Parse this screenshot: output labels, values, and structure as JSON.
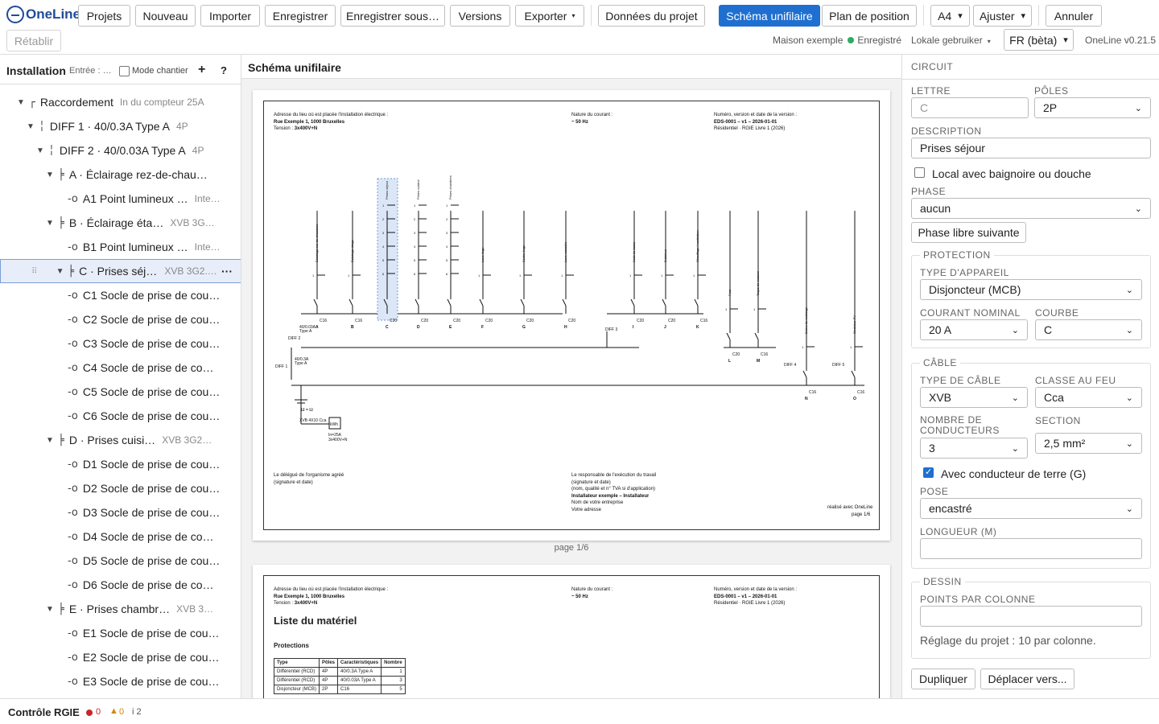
{
  "app": {
    "logo": "OneLine",
    "version": "OneLine v0.21.5"
  },
  "toolbar": {
    "projects": "Projets",
    "new": "Nouveau",
    "import": "Importer",
    "save": "Enregistrer",
    "save_as": "Enregistrer sous…",
    "versions": "Versions",
    "export": "Exporter",
    "project_data": "Données du projet",
    "single_line": "Schéma unifilaire",
    "position_plan": "Plan de position",
    "paper": "A4",
    "fit": "Ajuster",
    "undo": "Annuler",
    "redo": "Rétablir",
    "project_name": "Maison exemple",
    "saved": "Enregistré",
    "locale_user": "Lokale gebruiker",
    "language": "FR (bèta)"
  },
  "left": {
    "title": "Installation",
    "entry": "Entrée : …",
    "site_mode": "Mode chantier",
    "add": "+",
    "help": "?",
    "tree": [
      {
        "indent": 0,
        "tw": "▼",
        "icon": "┌",
        "label": "Raccordement",
        "sub": "In du compteur 25A"
      },
      {
        "indent": 1,
        "tw": "▼",
        "icon": "╎",
        "label": "DIFF 1 · 40/0.3A Type A",
        "sub": "4P"
      },
      {
        "indent": 2,
        "tw": "▼",
        "icon": "╎",
        "label": "DIFF 2 · 40/0.03A Type A",
        "sub": "4P"
      },
      {
        "indent": 3,
        "tw": "▼",
        "icon": "╞",
        "label": "A · Éclairage rez-de-chau…",
        "sub": ""
      },
      {
        "indent": 4,
        "tw": "",
        "icon": "-o",
        "label": "A1 Point lumineux …",
        "sub": "Inte…"
      },
      {
        "indent": 3,
        "tw": "▼",
        "icon": "╞",
        "label": "B · Éclairage éta…",
        "sub": "XVB 3G…"
      },
      {
        "indent": 4,
        "tw": "",
        "icon": "-o",
        "label": "B1 Point lumineux …",
        "sub": "Inte…"
      },
      {
        "indent": 3,
        "tw": "▼",
        "icon": "╞",
        "label": "C · Prises séjo…",
        "sub": "XVB 3G2.5 …",
        "selected": true
      },
      {
        "indent": 4,
        "tw": "",
        "icon": "-o",
        "label": "C1 Socle de prise de cou…",
        "sub": ""
      },
      {
        "indent": 4,
        "tw": "",
        "icon": "-o",
        "label": "C2 Socle de prise de cou…",
        "sub": ""
      },
      {
        "indent": 4,
        "tw": "",
        "icon": "-o",
        "label": "C3 Socle de prise de cou…",
        "sub": ""
      },
      {
        "indent": 4,
        "tw": "",
        "icon": "-o",
        "label": "C4 Socle de prise de co…",
        "sub": ""
      },
      {
        "indent": 4,
        "tw": "",
        "icon": "-o",
        "label": "C5 Socle de prise de cou…",
        "sub": ""
      },
      {
        "indent": 4,
        "tw": "",
        "icon": "-o",
        "label": "C6 Socle de prise de cou…",
        "sub": ""
      },
      {
        "indent": 3,
        "tw": "▼",
        "icon": "╞",
        "label": "D · Prises cuisi…",
        "sub": "XVB 3G2…"
      },
      {
        "indent": 4,
        "tw": "",
        "icon": "-o",
        "label": "D1 Socle de prise de cou…",
        "sub": ""
      },
      {
        "indent": 4,
        "tw": "",
        "icon": "-o",
        "label": "D2 Socle de prise de cou…",
        "sub": ""
      },
      {
        "indent": 4,
        "tw": "",
        "icon": "-o",
        "label": "D3 Socle de prise de cou…",
        "sub": ""
      },
      {
        "indent": 4,
        "tw": "",
        "icon": "-o",
        "label": "D4 Socle de prise de co…",
        "sub": ""
      },
      {
        "indent": 4,
        "tw": "",
        "icon": "-o",
        "label": "D5 Socle de prise de cou…",
        "sub": ""
      },
      {
        "indent": 4,
        "tw": "",
        "icon": "-o",
        "label": "D6 Socle de prise de co…",
        "sub": ""
      },
      {
        "indent": 3,
        "tw": "▼",
        "icon": "╞",
        "label": "E · Prises chambr…",
        "sub": "XVB 3…"
      },
      {
        "indent": 4,
        "tw": "",
        "icon": "-o",
        "label": "E1 Socle de prise de cou…",
        "sub": ""
      },
      {
        "indent": 4,
        "tw": "",
        "icon": "-o",
        "label": "E2 Socle de prise de cou…",
        "sub": ""
      },
      {
        "indent": 4,
        "tw": "",
        "icon": "-o",
        "label": "E3 Socle de prise de cou…",
        "sub": ""
      }
    ]
  },
  "status": {
    "label": "Contrôle RGIE",
    "errors": "0",
    "warnings": "0",
    "info": "i 2"
  },
  "center": {
    "title": "Schéma unifilaire",
    "page1_label": "page 1/6",
    "header": {
      "addr_label": "Adresse du lieu où est placée l'installation électrique :",
      "addr": "Rue Exemple 1, 1000 Bruxelles",
      "tension_label": "Tension :",
      "tension": "3x400V+N",
      "current_label": "Nature du courant :",
      "current": "~ 50 Hz",
      "version_label": "Numéro, version et date de la version :",
      "version": "EDS-0001 – v1 – 2026-01-01",
      "residential": "Résidentiel · RGIE Livre 1 (2026)"
    },
    "footer": {
      "delegate": "Le délégué de l'organisme agréé",
      "delegate_sub": "(signature et date)",
      "resp": "Le responsable de l'exécution du travail",
      "resp_sub1": "(signature et date)",
      "resp_sub2": "(nom, qualité et n° TVA si d'application)",
      "resp_company": "Installateur exemple – Installateur",
      "resp_company_sub": "Nom de votre entreprise",
      "resp_addr": "Votre adresse",
      "made_with": "réalisé avec OneLine",
      "page": "page 1/6"
    },
    "diagram": {
      "diff2": "DIFF 2",
      "diff2_rating": "40/0.03A",
      "diff2_type": "Type A",
      "diff1": "DIFF 1",
      "diff1_rating": "40/0.3A",
      "diff1_type": "Type A",
      "diff3": "DIFF 3",
      "diff4": "DIFF 4",
      "diff5": "DIFF 5",
      "meter": "kWh",
      "meter_in": "In=25A",
      "meter_tension": "3x400V+N",
      "earth": "Ш = Ш",
      "earth_cable": "XVB 4X10 Cca",
      "circuits": [
        {
          "id": "A",
          "rating": "C16",
          "name": "Éclairage rez-de-chaussée",
          "n": 1
        },
        {
          "id": "B",
          "rating": "C16",
          "name": "Éclairage étage",
          "n": 1
        },
        {
          "id": "C",
          "rating": "C20",
          "name": "Prises séjour",
          "n": 6
        },
        {
          "id": "D",
          "rating": "C20",
          "name": "Prises cuisine",
          "n": 6
        },
        {
          "id": "E",
          "rating": "C20",
          "name": "Prises chambres",
          "n": 6
        },
        {
          "id": "F",
          "rating": "C20",
          "name": "Lave-linge",
          "n": 1
        },
        {
          "id": "G",
          "rating": "C20",
          "name": "Sèche-linge",
          "n": 1
        },
        {
          "id": "H",
          "rating": "C20",
          "name": "Lave-vaisselle",
          "n": 1
        },
        {
          "id": "I",
          "rating": "C20",
          "name": "Salle de bains",
          "n": 1
        },
        {
          "id": "J",
          "rating": "C20",
          "name": "Extérieur",
          "n": 1
        },
        {
          "id": "K",
          "rating": "C16",
          "name": "Chauffage / ventilation",
          "n": 1
        },
        {
          "id": "L",
          "rating": "C20",
          "name": "Four",
          "n": 1
        },
        {
          "id": "M",
          "rating": "C16",
          "name": "Taque de cuisson",
          "n": 1
        },
        {
          "id": "N",
          "rating": "C16",
          "name": "Borne de recharge",
          "n": 1
        },
        {
          "id": "O",
          "rating": "C16",
          "name": "Onduleur PV",
          "n": 1
        }
      ]
    },
    "page2": {
      "title": "Liste du matériel",
      "section": "Protections",
      "columns": [
        "Type",
        "Pôles",
        "Caractéristiques",
        "Nombre"
      ],
      "rows": [
        [
          "Différentiel (RCD)",
          "4P",
          "40/0.3A Type A",
          "1"
        ],
        [
          "Différentiel (RCD)",
          "4P",
          "40/0.03A Type A",
          "3"
        ],
        [
          "Disjoncteur (MCB)",
          "2P",
          "C16",
          "5"
        ]
      ]
    }
  },
  "right": {
    "section": "CIRCUIT",
    "letter_label": "LETTRE",
    "letter_placeholder": "C",
    "poles_label": "PÔLES",
    "poles": "2P",
    "description_label": "DESCRIPTION",
    "description": "Prises séjour",
    "bath_label": "Local avec baignoire ou douche",
    "phase_label": "PHASE",
    "phase": "aucun",
    "next_phase": "Phase libre suivante",
    "protection_legend": "PROTECTION",
    "device_type_label": "TYPE D'APPAREIL",
    "device_type": "Disjoncteur (MCB)",
    "nominal_label": "COURANT NOMINAL",
    "nominal": "20 A",
    "curve_label": "COURBE",
    "curve": "C",
    "cable_legend": "CÂBLE",
    "cable_type_label": "TYPE DE CÂBLE",
    "cable_type": "XVB",
    "fire_label": "CLASSE AU FEU",
    "fire": "Cca",
    "conductors_label": "NOMBRE DE CONDUCTEURS",
    "conductors": "3",
    "section_label": "SECTION",
    "section_value": "2,5 mm²",
    "earth_label": "Avec conducteur de terre (G)",
    "laying_label": "POSE",
    "laying": "encastré",
    "length_label": "LONGUEUR (M)",
    "drawing_legend": "DESSIN",
    "points_label": "POINTS PAR COLONNE",
    "project_setting": "Réglage du projet : 10 par colonne.",
    "duplicate": "Dupliquer",
    "move": "Déplacer vers..."
  },
  "colors": {
    "accent": "#1f6fd0",
    "saved": "#2eab5f",
    "error": "#c62828",
    "warning": "#d08a00"
  }
}
